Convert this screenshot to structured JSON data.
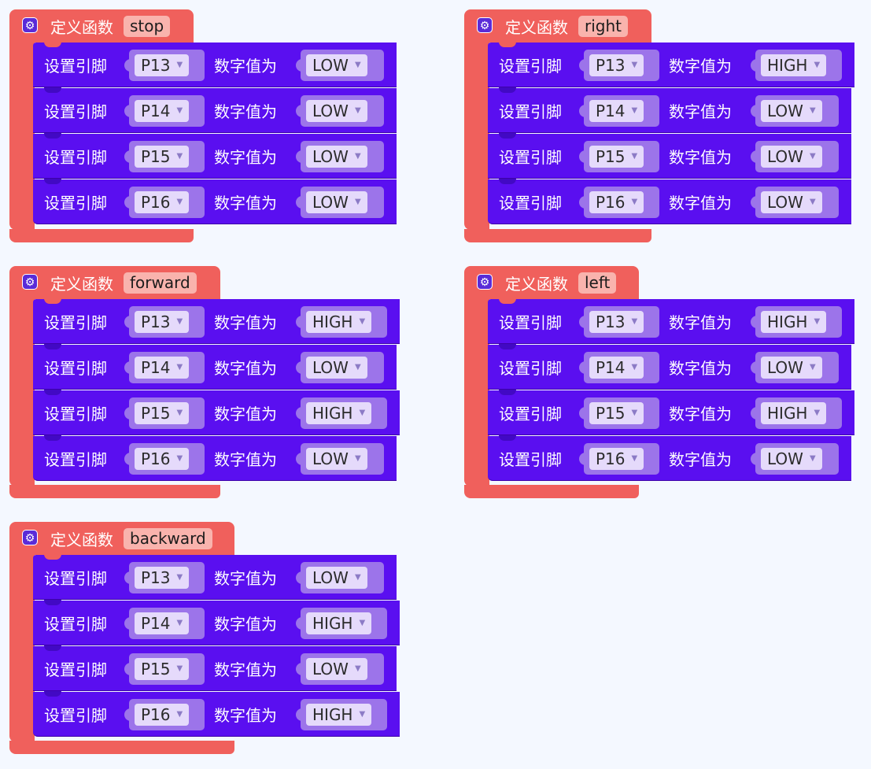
{
  "labels": {
    "define": "定义函数",
    "set_pin": "设置引脚",
    "digital_value": "数字值为",
    "gear_icon": "gear-icon"
  },
  "colors": {
    "workspace_bg": "#f4f8ff",
    "function_block": "#f0605c",
    "function_name_field": "#f9b3ad",
    "statement_block": "#5a0ff0",
    "input_slot": "#9c74ea",
    "dropdown_chip": "#e5dafb"
  },
  "functions": [
    {
      "name": "stop",
      "rows": [
        {
          "pin": "P13",
          "value": "LOW"
        },
        {
          "pin": "P14",
          "value": "LOW"
        },
        {
          "pin": "P15",
          "value": "LOW"
        },
        {
          "pin": "P16",
          "value": "LOW"
        }
      ]
    },
    {
      "name": "right",
      "rows": [
        {
          "pin": "P13",
          "value": "HIGH"
        },
        {
          "pin": "P14",
          "value": "LOW"
        },
        {
          "pin": "P15",
          "value": "LOW"
        },
        {
          "pin": "P16",
          "value": "LOW"
        }
      ]
    },
    {
      "name": "forward",
      "rows": [
        {
          "pin": "P13",
          "value": "HIGH"
        },
        {
          "pin": "P14",
          "value": "LOW"
        },
        {
          "pin": "P15",
          "value": "HIGH"
        },
        {
          "pin": "P16",
          "value": "LOW"
        }
      ]
    },
    {
      "name": "left",
      "rows": [
        {
          "pin": "P13",
          "value": "HIGH"
        },
        {
          "pin": "P14",
          "value": "LOW"
        },
        {
          "pin": "P15",
          "value": "HIGH"
        },
        {
          "pin": "P16",
          "value": "LOW"
        }
      ]
    },
    {
      "name": "backward",
      "rows": [
        {
          "pin": "P13",
          "value": "LOW"
        },
        {
          "pin": "P14",
          "value": "HIGH"
        },
        {
          "pin": "P15",
          "value": "LOW"
        },
        {
          "pin": "P16",
          "value": "HIGH"
        }
      ]
    }
  ]
}
